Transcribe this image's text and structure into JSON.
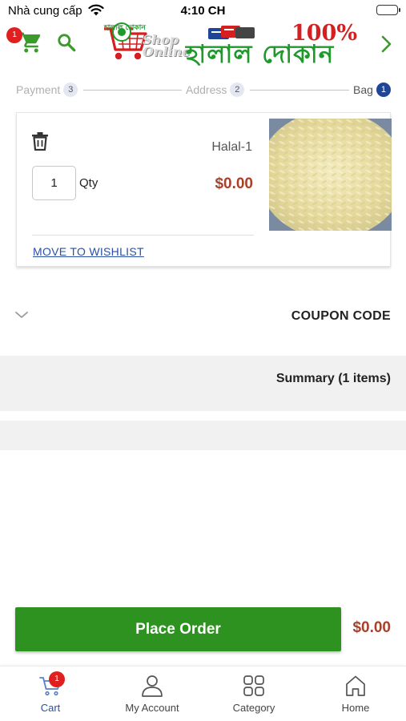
{
  "status_bar": {
    "carrier": "Nhà cung cấp",
    "time": "4:10 CH"
  },
  "header": {
    "cart_badge": "1",
    "logo": {
      "top_text": "হালাল দোকান",
      "shop_text": "Shop Online",
      "title_text": "হালাল দোকান",
      "hundred_text": "100%"
    }
  },
  "steps": [
    {
      "label": "Payment",
      "number": "3",
      "active": false
    },
    {
      "label": "Address",
      "number": "2",
      "active": false
    },
    {
      "label": "Bag",
      "number": "1",
      "active": true
    }
  ],
  "cart_item": {
    "name": "Halal-1",
    "quantity": "1",
    "qty_label": "Qty",
    "price": "$0.00",
    "wishlist_label": "MOVE TO WISHLIST"
  },
  "coupon": {
    "label": "COUPON CODE"
  },
  "summary": {
    "label": "Summary (1 items)"
  },
  "order": {
    "button_label": "Place Order",
    "total": "$0.00"
  },
  "bottom_nav": {
    "items": [
      {
        "label": "Cart",
        "icon": "cart-icon",
        "active": true,
        "badge": "1"
      },
      {
        "label": "My Account",
        "icon": "account-icon",
        "active": false
      },
      {
        "label": "Category",
        "icon": "category-icon",
        "active": false
      },
      {
        "label": "Home",
        "icon": "home-icon",
        "active": false
      }
    ]
  },
  "colors": {
    "brand_green": "#2e9220",
    "price_red": "#a8402a",
    "link_blue": "#2b4fa3",
    "active_step": "#1f4599",
    "badge_red": "#e02020"
  }
}
